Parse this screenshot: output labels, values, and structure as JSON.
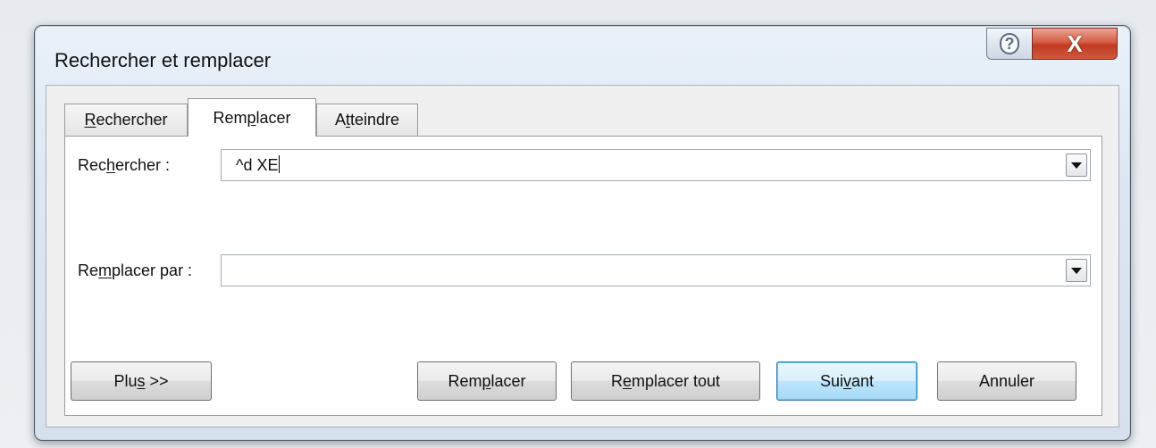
{
  "dialog": {
    "title": "Rechercher et remplacer",
    "help_glyph": "?",
    "close_glyph": "X"
  },
  "tabs": [
    {
      "pre": "",
      "mnemonic": "R",
      "post": "echercher"
    },
    {
      "pre": "Rem",
      "mnemonic": "p",
      "post": "lacer",
      "active": true
    },
    {
      "pre": "A",
      "mnemonic": "t",
      "post": "teindre"
    }
  ],
  "find": {
    "label_pre": "Rec",
    "label_mnemonic": "h",
    "label_post": "ercher :",
    "value": "^d XE"
  },
  "replace": {
    "label_pre": "Re",
    "label_mnemonic": "m",
    "label_post": "placer par :",
    "value": ""
  },
  "buttons": {
    "more": {
      "pre": "Plu",
      "mnemonic": "s",
      "post": " >>"
    },
    "replace": {
      "pre": "Rem",
      "mnemonic": "p",
      "post": "lacer"
    },
    "replace_all": {
      "pre": "R",
      "mnemonic": "e",
      "post": "mplacer tout"
    },
    "next": {
      "pre": "Sui",
      "mnemonic": "v",
      "post": "ant"
    },
    "cancel": {
      "pre": "Annuler",
      "mnemonic": "",
      "post": ""
    }
  },
  "colors": {
    "close_button": "#c13a22",
    "default_button_border": "#3c7fb1"
  }
}
